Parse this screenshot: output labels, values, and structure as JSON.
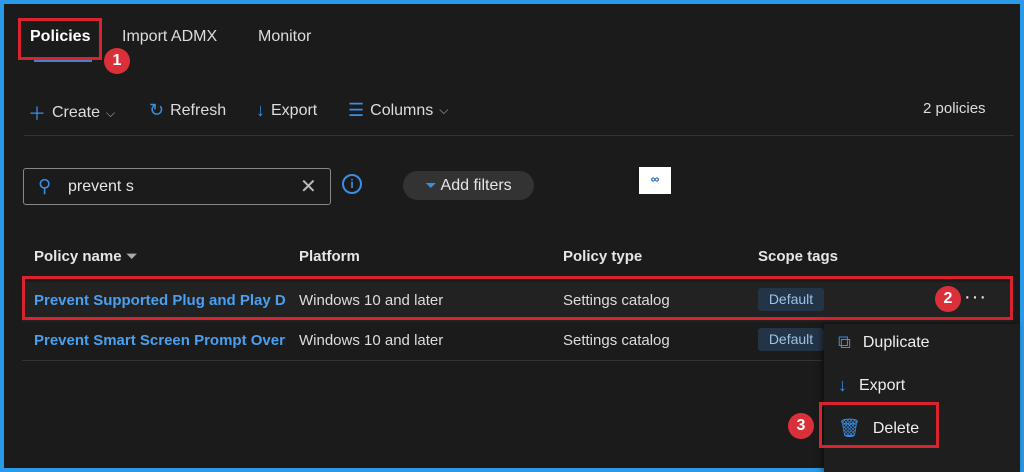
{
  "tabs": [
    {
      "label": "Policies"
    },
    {
      "label": "Import ADMX"
    },
    {
      "label": "Monitor"
    }
  ],
  "toolbar": {
    "create": "Create",
    "refresh": "Refresh",
    "export": "Export",
    "columns": "Columns",
    "count": "2 policies"
  },
  "search": {
    "value": "prevent s"
  },
  "filters": {
    "add": "Add filters"
  },
  "table": {
    "headers": [
      "Policy name",
      "Platform",
      "Policy type",
      "Scope tags"
    ],
    "rows": [
      {
        "name": "Prevent Supported Plug and Play Device",
        "platform": "Windows 10 and later",
        "type": "Settings catalog",
        "scope": "Default"
      },
      {
        "name": "Prevent Smart Screen Prompt Override",
        "platform": "Windows 10 and later",
        "type": "Settings catalog",
        "scope": "Default"
      }
    ]
  },
  "context_menu": {
    "duplicate": "Duplicate",
    "export": "Export",
    "delete": "Delete"
  },
  "annotations": [
    "1",
    "2",
    "3"
  ],
  "colors": {
    "accent": "#3a8ee6",
    "highlight": "#d9232e",
    "frame": "#2b9ae8"
  }
}
